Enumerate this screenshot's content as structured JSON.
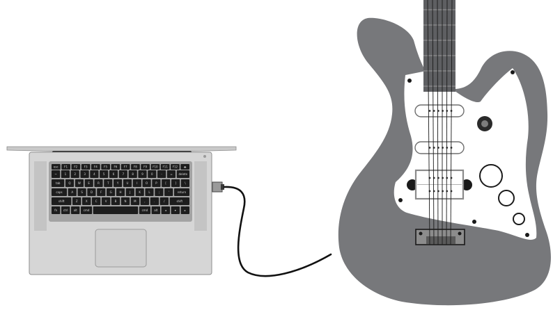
{
  "scene": {
    "background": "#ffffff",
    "laptop": {
      "body_color": "#d4d4d4",
      "keyboard_well": "#9a9a9a",
      "key_color": "#1d1d1d"
    },
    "cable": {
      "color": "#111111"
    },
    "guitar": {
      "body_color": "#77787b",
      "pickguard_color": "#ffffff",
      "neck_color": "#5e5f62",
      "strings": 6,
      "single_coil_pickups": 2,
      "humbucker_pickups": 1,
      "knobs": 3,
      "highlighted_component": "bridge pickup"
    }
  },
  "keyboard_rows": [
    [
      "esc",
      "F1",
      "F2",
      "F3",
      "F4",
      "F5",
      "F6",
      "F7",
      "F8",
      "F9",
      "F10",
      "F11",
      "F12",
      "⏏"
    ],
    [
      "~",
      "1",
      "2",
      "3",
      "4",
      "5",
      "6",
      "7",
      "8",
      "9",
      "0",
      "-",
      "=",
      "delete"
    ],
    [
      "tab",
      "Q",
      "W",
      "E",
      "R",
      "T",
      "Y",
      "U",
      "I",
      "O",
      "P",
      "[",
      "]",
      "\\"
    ],
    [
      "caps",
      "A",
      "S",
      "D",
      "F",
      "G",
      "H",
      "J",
      "K",
      "L",
      ";",
      "'",
      "return"
    ],
    [
      "shift",
      "Z",
      "X",
      "C",
      "V",
      "B",
      "N",
      "M",
      ",",
      ".",
      "/",
      "shift"
    ],
    [
      "fn",
      "ctrl",
      "alt",
      "cmd",
      "",
      "cmd",
      "alt",
      "◂",
      "▾",
      "▸"
    ]
  ]
}
